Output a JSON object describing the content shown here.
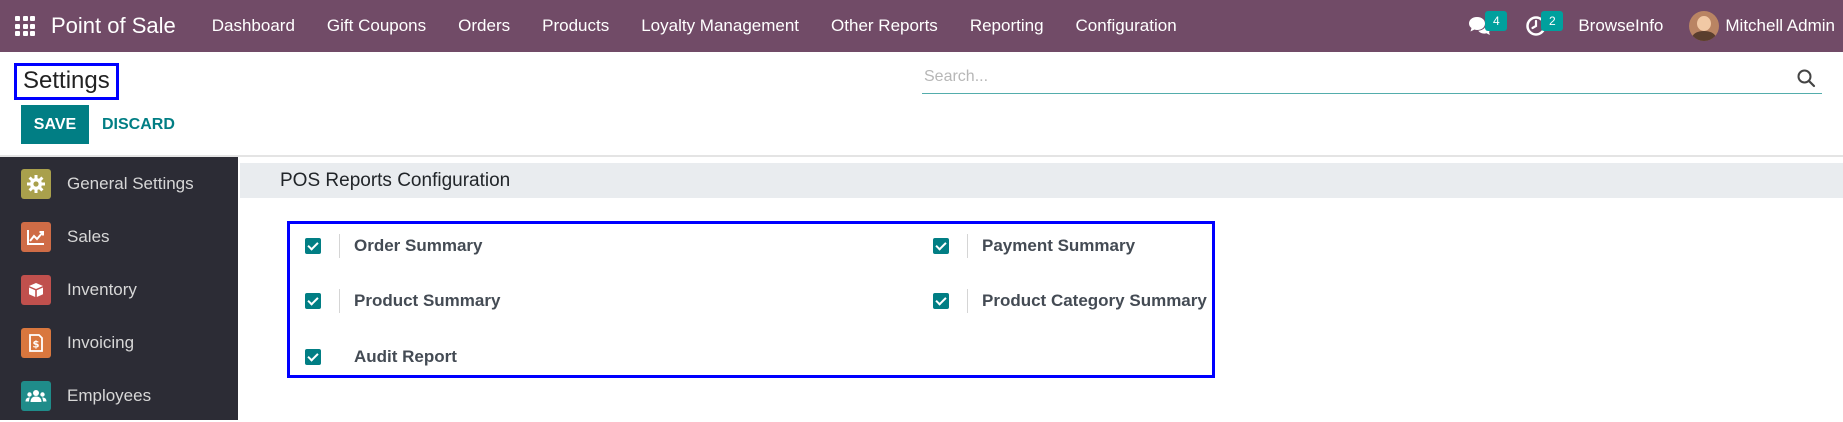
{
  "navbar": {
    "app_name": "Point of Sale",
    "menu": [
      "Dashboard",
      "Gift Coupons",
      "Orders",
      "Products",
      "Loyalty Management",
      "Other Reports",
      "Reporting",
      "Configuration"
    ],
    "messages_count": "4",
    "activities_count": "2",
    "company": "BrowseInfo",
    "user": "Mitchell Admin"
  },
  "control_panel": {
    "title": "Settings",
    "search_placeholder": "Search...",
    "save_label": "SAVE",
    "discard_label": "DISCARD"
  },
  "sidebar": {
    "items": [
      {
        "label": "General Settings",
        "icon": "gear-icon",
        "color": "#a9a04c"
      },
      {
        "label": "Sales",
        "icon": "chart-line-icon",
        "color": "#cf6c46"
      },
      {
        "label": "Inventory",
        "icon": "box-icon",
        "color": "#c0504d"
      },
      {
        "label": "Invoicing",
        "icon": "invoice-icon",
        "color": "#d9773e"
      },
      {
        "label": "Employees",
        "icon": "users-icon",
        "color": "#1f8c8a"
      }
    ]
  },
  "section": {
    "title": "POS Reports Configuration",
    "settings": [
      {
        "label": "Order Summary",
        "checked": true
      },
      {
        "label": "Payment Summary",
        "checked": true
      },
      {
        "label": "Product Summary",
        "checked": true
      },
      {
        "label": "Product Category Summary",
        "checked": true
      },
      {
        "label": "Audit Report",
        "checked": true
      }
    ]
  },
  "colors": {
    "navbar": "#714b67",
    "accent": "#017e84",
    "sidebar": "#2c2c35",
    "highlight_box": "#0000ff"
  }
}
